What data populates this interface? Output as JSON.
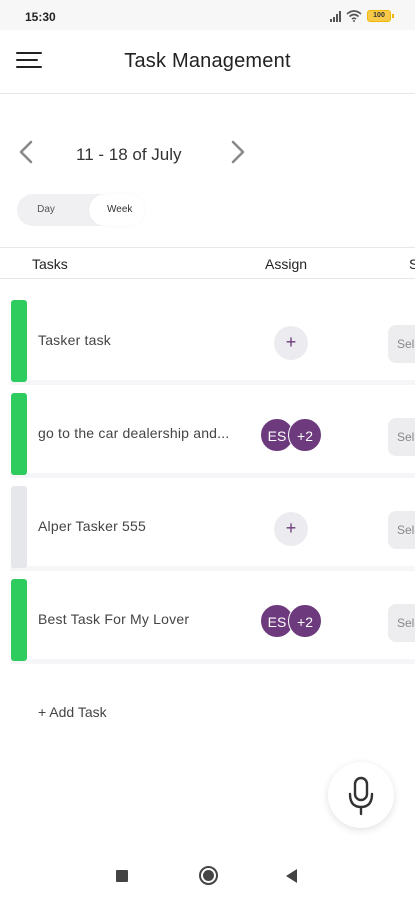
{
  "status_bar": {
    "time": "15:30",
    "battery": "100"
  },
  "header": {
    "title": "Task Management"
  },
  "date_nav": {
    "range": "11 - 18 of July"
  },
  "view_toggle": {
    "day_label": "Day",
    "week_label": "Week",
    "selected": "Week"
  },
  "table": {
    "columns": {
      "tasks": "Tasks",
      "assign": "Assign",
      "status": "S"
    }
  },
  "tasks": [
    {
      "name": "Tasker task",
      "bar_color": "#2ecc5e",
      "assignees": null,
      "add_label": "+",
      "status_label": "Sel"
    },
    {
      "name": "go to the car dealership and...",
      "bar_color": "#2ecc5e",
      "assignees": {
        "first": "ES",
        "more": "+2"
      },
      "status_label": "Sel"
    },
    {
      "name": "Alper Tasker 555",
      "bar_color": "#e6e7ea",
      "assignees": null,
      "add_label": "+",
      "status_label": "Sel"
    },
    {
      "name": "Best Task For My Lover",
      "bar_color": "#2ecc5e",
      "assignees": {
        "first": "ES",
        "more": "+2"
      },
      "status_label": "Sel"
    }
  ],
  "add_task_label": "+ Add Task",
  "colors": {
    "accent": "#6c3a7d",
    "green": "#2ecc5e",
    "neutral": "#e6e7ea"
  },
  "icons": {
    "menu": "hamburger-icon",
    "prev": "chevron-left-icon",
    "next": "chevron-right-icon",
    "mic": "microphone-icon"
  }
}
